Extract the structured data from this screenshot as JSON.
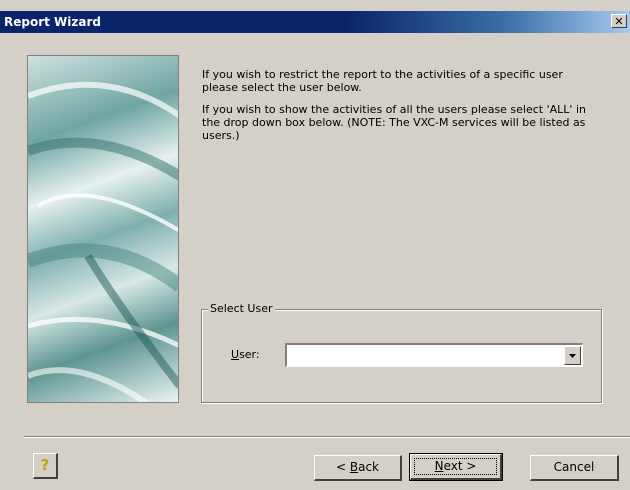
{
  "window": {
    "title": "Report Wizard",
    "close_label": "✕"
  },
  "instructions": {
    "paragraph1": "If you wish to restrict the report to the activities of a specific user please select the user below.",
    "paragraph2": "If you wish to show the activities of all the users please select 'ALL' in the drop down box below.  (NOTE: The VXC-M services will be listed as users.)"
  },
  "select_user": {
    "group_label": "Select User",
    "user_label_accel": "U",
    "user_label_rest": "ser:",
    "user_value": ""
  },
  "buttons": {
    "help_label": "?",
    "back_prefix": "< ",
    "back_accel": "B",
    "back_rest": "ack",
    "next_accel": "N",
    "next_rest": "ext >",
    "cancel_label": "Cancel"
  },
  "colors": {
    "titlebar": "#0a246a",
    "face": "#d4d0c8"
  }
}
